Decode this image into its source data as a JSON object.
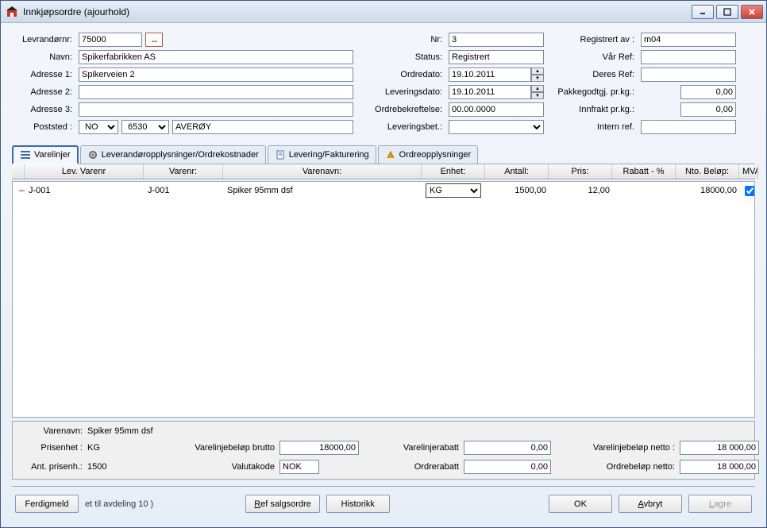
{
  "window": {
    "title": "Innkjøpsordre (ajourhold)"
  },
  "header": {
    "labels": {
      "suppno": "Levrandørnr:",
      "name": "Navn:",
      "addr1": "Adresse 1:",
      "addr2": "Adresse 2:",
      "addr3": "Adresse 3:",
      "post": "Poststed :",
      "nr": "Nr:",
      "status": "Status:",
      "orderdate": "Ordredato:",
      "delivdate": "Leveringsdato:",
      "confirm": "Ordrebekreftelse:",
      "delivterms": "Leveringsbet.:",
      "regby": "Registrert av :",
      "ourref": "Vår Ref:",
      "theirref": "Deres Ref:",
      "pkgkg": "Pakkegodtgj. pr.kg.:",
      "freightkg": "Innfrakt pr.kg.:",
      "internref": "Intern ref."
    },
    "values": {
      "suppno": "75000",
      "name": "Spikerfabrikken AS",
      "addr1": "Spikerveien 2",
      "addr2": "",
      "addr3": "",
      "post_country": "NO",
      "post_code": "6530",
      "post_city": "AVERØY",
      "nr": "3",
      "status": "Registrert",
      "orderdate": "19.10.2011",
      "delivdate": "19.10.2011",
      "confirm": "00.00.0000",
      "delivterms": "",
      "regby": "m04",
      "ourref": "",
      "theirref": "",
      "pkgkg": "0,00",
      "freightkg": "0,00",
      "internref": ""
    }
  },
  "tabs": {
    "t1": "Varelinjer",
    "t2": "Leverandøropplysninger/Ordrekostnader",
    "t3": "Levering/Fakturering",
    "t4": "Ordreopplysninger"
  },
  "grid": {
    "headers": {
      "levvar": "Lev. Varenr",
      "varenr": "Varenr:",
      "varenavn": "Varenavn:",
      "enhet": "Enhet:",
      "antall": "Antall:",
      "pris": "Pris:",
      "rabatt": "Rabatt - %",
      "nto": "Nto. Beløp:",
      "mva": "MVA"
    },
    "rows": [
      {
        "levvar": "J-001",
        "varenr": "J-001",
        "varenavn": "Spiker 95mm dsf",
        "enhet": "KG",
        "antall": "1500,00",
        "pris": "12,00",
        "rabatt": "",
        "nto": "18000,00",
        "mva": true
      }
    ]
  },
  "summary": {
    "labels": {
      "varenavn": "Varenavn:",
      "prisenhet": "Prisenhet :",
      "antprisenh": "Ant. prisenh.:",
      "linjebrutto": "Varelinjebeløp brutto",
      "valuta": "Valutakode",
      "linjerabatt": "Varelinjerabatt",
      "ordrerabatt": "Ordrerabatt",
      "linjenetto": "Varelinjebeløp netto :",
      "ordrenetto": "Ordrebeløp netto:"
    },
    "values": {
      "varenavn": "Spiker 95mm dsf",
      "prisenhet": "KG",
      "antprisenh": "1500",
      "linjebrutto": "18000,00",
      "valuta": "NOK",
      "linjerabatt": "0,00",
      "ordrerabatt": "0,00",
      "linjenetto": "18 000,00",
      "ordrenetto": "18 000,00"
    }
  },
  "footer": {
    "ferdigmeld": "Ferdigmeld",
    "status_fragment": "et til avdeling 10 )",
    "refsalgs": "Ref salgsordre",
    "historikk": "Historikk",
    "ok": "OK",
    "avbryt": "Avbryt",
    "lagre": "Lagre"
  }
}
